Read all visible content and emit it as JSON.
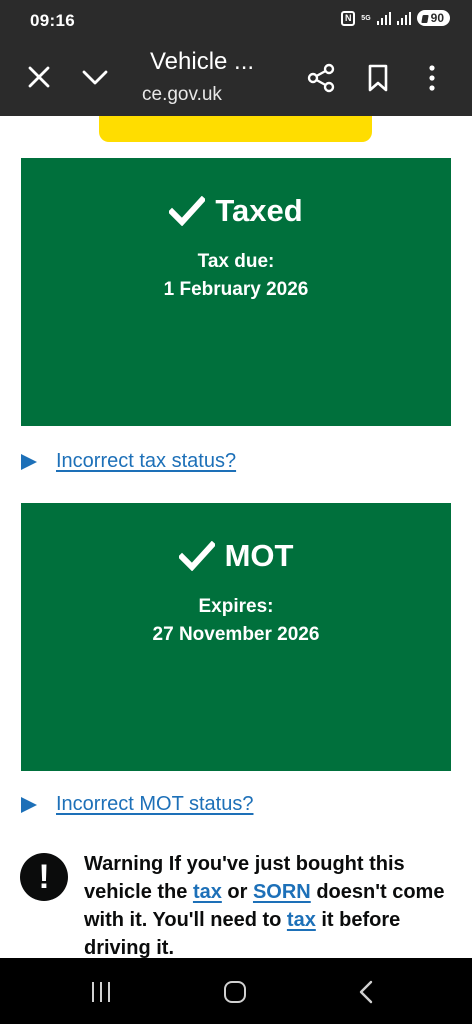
{
  "status_bar": {
    "time": "09:16",
    "nfc": "N",
    "network": "5G",
    "battery": "90"
  },
  "browser": {
    "title": "Vehicle ...",
    "domain": "ce.gov.uk",
    "icons": [
      "close-icon",
      "chevron-down-icon",
      "share-icon",
      "bookmark-icon",
      "more-vert-icon"
    ]
  },
  "tax_panel": {
    "heading": "Taxed",
    "label": "Tax due:",
    "value": "1 February 2026"
  },
  "tax_details": {
    "link": "Incorrect tax status?"
  },
  "mot_panel": {
    "heading": "MOT",
    "label": "Expires:",
    "value": "27 November 2026"
  },
  "mot_details": {
    "link": "Incorrect MOT status?"
  },
  "warning": {
    "icon": "!",
    "text_1": "Warning If you've just bought this vehicle the ",
    "link_tax": "tax",
    "text_2": " or ",
    "link_sorn": "SORN",
    "text_3": " doesn't come with it. You'll need to ",
    "link_tax_2": "tax",
    "text_4": " it before driving it."
  },
  "colors": {
    "gov_green": "#00703c",
    "link_blue": "#1d70b8",
    "plate_yellow": "#ffdd00",
    "chrome_dark": "#2b2b2b"
  }
}
